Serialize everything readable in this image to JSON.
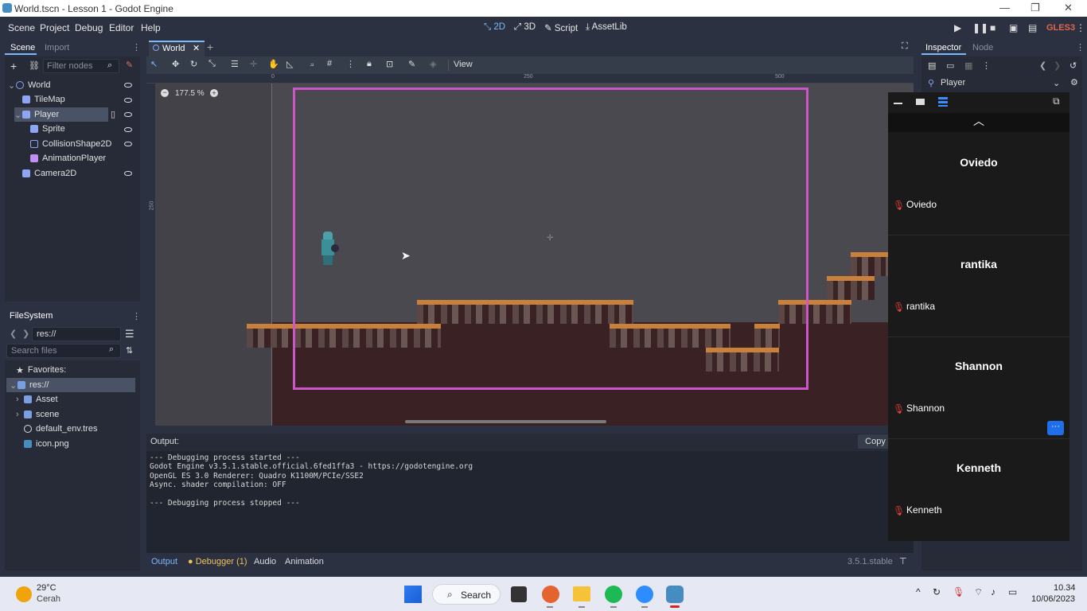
{
  "window": {
    "title": "World.tscn - Lesson 1 - Godot Engine",
    "minimize": "—",
    "maximize": "❐",
    "close": "✕"
  },
  "menus": [
    "Scene",
    "Project",
    "Debug",
    "Editor",
    "Help"
  ],
  "workspaces": {
    "twod": "2D",
    "threed": "3D",
    "script": "Script",
    "assetlib": "AssetLib"
  },
  "renderer": "GLES3",
  "scene_dock": {
    "tabs": [
      "Scene",
      "Import"
    ],
    "filter_placeholder": "Filter nodes",
    "nodes": [
      {
        "name": "World",
        "depth": 0,
        "color": "#8da5f3"
      },
      {
        "name": "TileMap",
        "depth": 1,
        "color": "#8da5f3"
      },
      {
        "name": "Player",
        "depth": 1,
        "color": "#8da5f3"
      },
      {
        "name": "Sprite",
        "depth": 2,
        "color": "#8da5f3"
      },
      {
        "name": "CollisionShape2D",
        "depth": 2,
        "color": "#8da5f3"
      },
      {
        "name": "AnimationPlayer",
        "depth": 2,
        "color": "#c38ef1"
      },
      {
        "name": "Camera2D",
        "depth": 1,
        "color": "#8da5f3"
      }
    ]
  },
  "filesystem": {
    "title": "FileSystem",
    "path": "res://",
    "search_placeholder": "Search files",
    "favorites": "Favorites:",
    "items": [
      {
        "name": "res://",
        "depth": 0,
        "type": "folder"
      },
      {
        "name": "Asset",
        "depth": 1,
        "type": "folder"
      },
      {
        "name": "scene",
        "depth": 1,
        "type": "folder"
      },
      {
        "name": "default_env.tres",
        "depth": 1,
        "type": "resource"
      },
      {
        "name": "icon.png",
        "depth": 1,
        "type": "image"
      }
    ]
  },
  "editor": {
    "scene_tab": "World",
    "view_menu": "View",
    "zoom": "177.5 %",
    "ruler_marks": [
      "0",
      "250",
      "500"
    ],
    "ruler_v_mark": "250"
  },
  "output": {
    "title": "Output:",
    "copy": "Copy",
    "lines": [
      "--- Debugging process started ---",
      "Godot Engine v3.5.1.stable.official.6fed1ffa3 - https://godotengine.org",
      "OpenGL ES 3.0 Renderer: Quadro K1100M/PCIe/SSE2",
      "Async. shader compilation: OFF",
      "",
      "--- Debugging process stopped ---"
    ]
  },
  "bottom_tabs": {
    "output": "Output",
    "debugger": "Debugger (1)",
    "audio": "Audio",
    "animation": "Animation"
  },
  "version": "3.5.1.stable",
  "inspector": {
    "tabs": [
      "Inspector",
      "Node"
    ],
    "object": "Player"
  },
  "zoom_participants": [
    "Oviedo",
    "rantika",
    "Shannon",
    "Kenneth"
  ],
  "taskbar": {
    "weather_temp": "29°C",
    "weather_desc": "Cerah",
    "search": "Search",
    "time": "10.34",
    "date": "10/06/2023"
  }
}
